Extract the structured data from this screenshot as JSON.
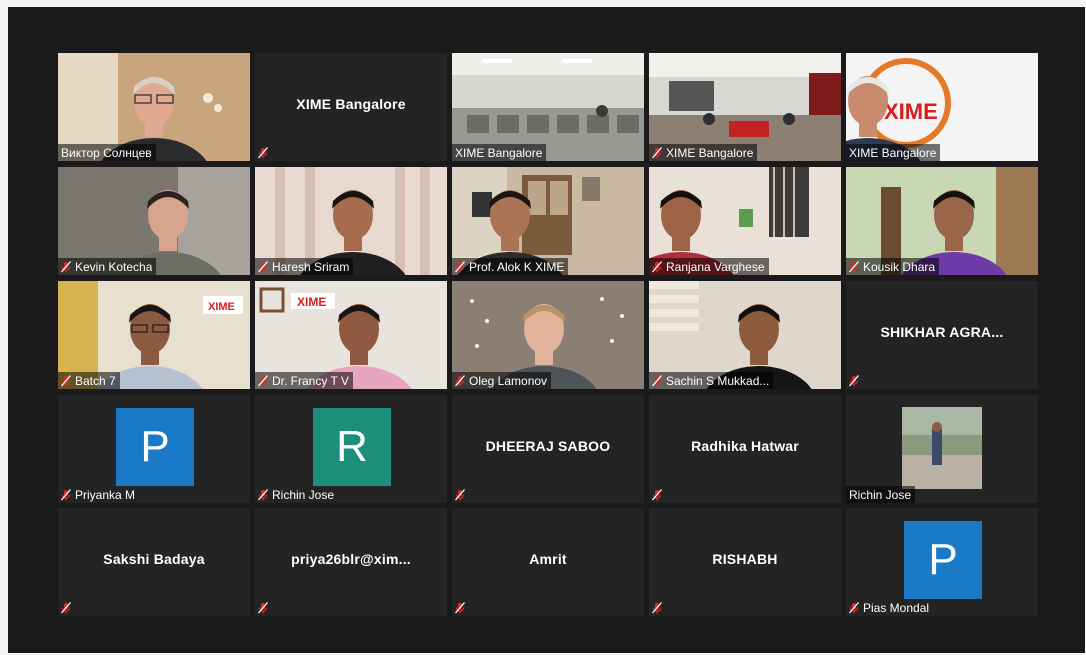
{
  "colors": {
    "background": "#1a1a1a",
    "tile": "#242424",
    "active_speaker_border": "#c8d83c",
    "muted_icon": "#e02828",
    "avatar_blue": "#1b7ac8",
    "avatar_teal": "#1b8f7a"
  },
  "icons": {
    "muted": "microphone-muted-icon"
  },
  "participants": [
    {
      "id": "p1",
      "label": "Виктор Солнцев",
      "kind": "video",
      "muted": false,
      "active": true,
      "scene": "speaker-home"
    },
    {
      "id": "p2",
      "label": "XIME Bangalore",
      "kind": "name",
      "muted": true
    },
    {
      "id": "p3",
      "label": "XIME Bangalore",
      "kind": "video",
      "muted": false,
      "scene": "classroom"
    },
    {
      "id": "p4",
      "label": "XIME Bangalore",
      "kind": "video",
      "muted": true,
      "scene": "classroom-front"
    },
    {
      "id": "p5",
      "label": "XIME Bangalore",
      "kind": "video",
      "muted": false,
      "scene": "logo-office",
      "logo_text": "XIME"
    },
    {
      "id": "p6",
      "label": "Kevin Kotecha",
      "kind": "video",
      "muted": true,
      "scene": "person-wall"
    },
    {
      "id": "p7",
      "label": "Haresh Sriram",
      "kind": "video",
      "muted": true,
      "scene": "person-curtain"
    },
    {
      "id": "p8",
      "label": "Prof. Alok K XIME",
      "kind": "video",
      "muted": true,
      "scene": "person-office"
    },
    {
      "id": "p9",
      "label": "Ranjana Varghese",
      "kind": "video",
      "muted": true,
      "scene": "person-room"
    },
    {
      "id": "p10",
      "label": "Kousik Dhara",
      "kind": "video",
      "muted": true,
      "scene": "person-green"
    },
    {
      "id": "p11",
      "label": "Batch 7",
      "kind": "video",
      "muted": true,
      "scene": "person-yellow",
      "logo_text": "XIME"
    },
    {
      "id": "p12",
      "label": "Dr. Francy T  V",
      "kind": "video",
      "muted": true,
      "scene": "person-pink",
      "logo_text": "XIME"
    },
    {
      "id": "p13",
      "label": "Oleg Lamonov",
      "kind": "video",
      "muted": true,
      "scene": "person-lights"
    },
    {
      "id": "p14",
      "label": "Sachin S Mukkad...",
      "kind": "video",
      "muted": true,
      "scene": "person-blinds"
    },
    {
      "id": "p15",
      "label": "SHIKHAR AGRA...",
      "kind": "name",
      "muted": true
    },
    {
      "id": "p16",
      "label": "Priyanka M",
      "kind": "avatar",
      "muted": true,
      "initial": "P",
      "avatar_color": "#1b7ac8"
    },
    {
      "id": "p17",
      "label": "Richin Jose",
      "kind": "avatar",
      "muted": true,
      "initial": "R",
      "avatar_color": "#1b8f7a"
    },
    {
      "id": "p18",
      "label": "DHEERAJ SABOO",
      "kind": "name",
      "muted": true
    },
    {
      "id": "p19",
      "label": "Radhika Hatwar",
      "kind": "name",
      "muted": true
    },
    {
      "id": "p20",
      "label": "Richin Jose",
      "kind": "photo",
      "muted": false,
      "scene": "outdoor-photo"
    },
    {
      "id": "p21",
      "label": "Sakshi Badaya",
      "kind": "name",
      "muted": true
    },
    {
      "id": "p22",
      "label": "priya26blr@xim...",
      "kind": "name",
      "muted": true
    },
    {
      "id": "p23",
      "label": "Amrit",
      "kind": "name",
      "muted": true
    },
    {
      "id": "p24",
      "label": "RISHABH",
      "kind": "name",
      "muted": true
    },
    {
      "id": "p25",
      "label": "Pias Mondal",
      "kind": "avatar",
      "muted": true,
      "initial": "P",
      "avatar_color": "#1b7ac8"
    }
  ]
}
